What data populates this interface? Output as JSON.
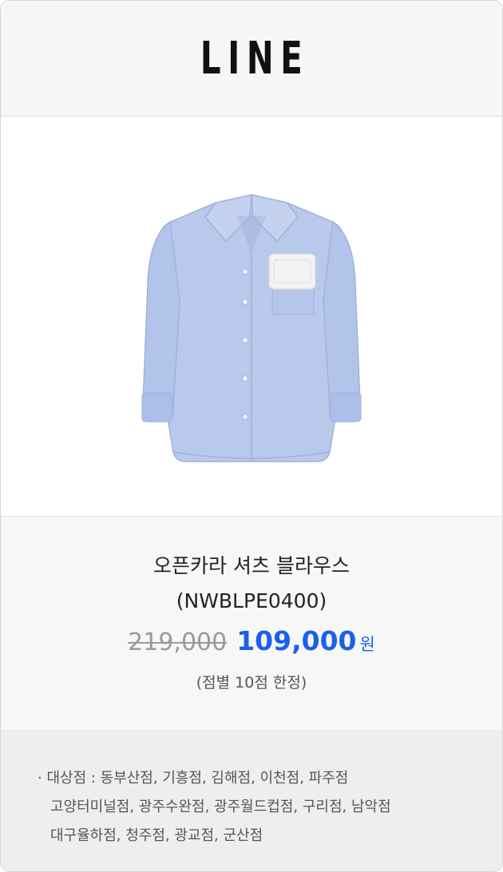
{
  "brand": {
    "name": "LINE"
  },
  "product": {
    "image_icon": "open-collar-shirt-image",
    "name": "오픈카라 셔츠 블라우스",
    "code": "(NWBLPE0400)",
    "original_price": "219,000",
    "sale_price": "109,000",
    "currency": "원",
    "limit_note": "(점별 10점 한정)"
  },
  "stores": {
    "lines": [
      "· 대상점 : 동부산점, 기흥점, 김해점, 이천점, 파주점",
      "고양터미널점, 광주수완점, 광주월드컵점, 구리점, 남악점",
      "대구율하점, 청주점, 광교점, 군산점"
    ]
  },
  "colors": {
    "sale": "#1b5ef0",
    "shirt": "#b9c9ec",
    "header_bg": "#f6f6f6"
  }
}
